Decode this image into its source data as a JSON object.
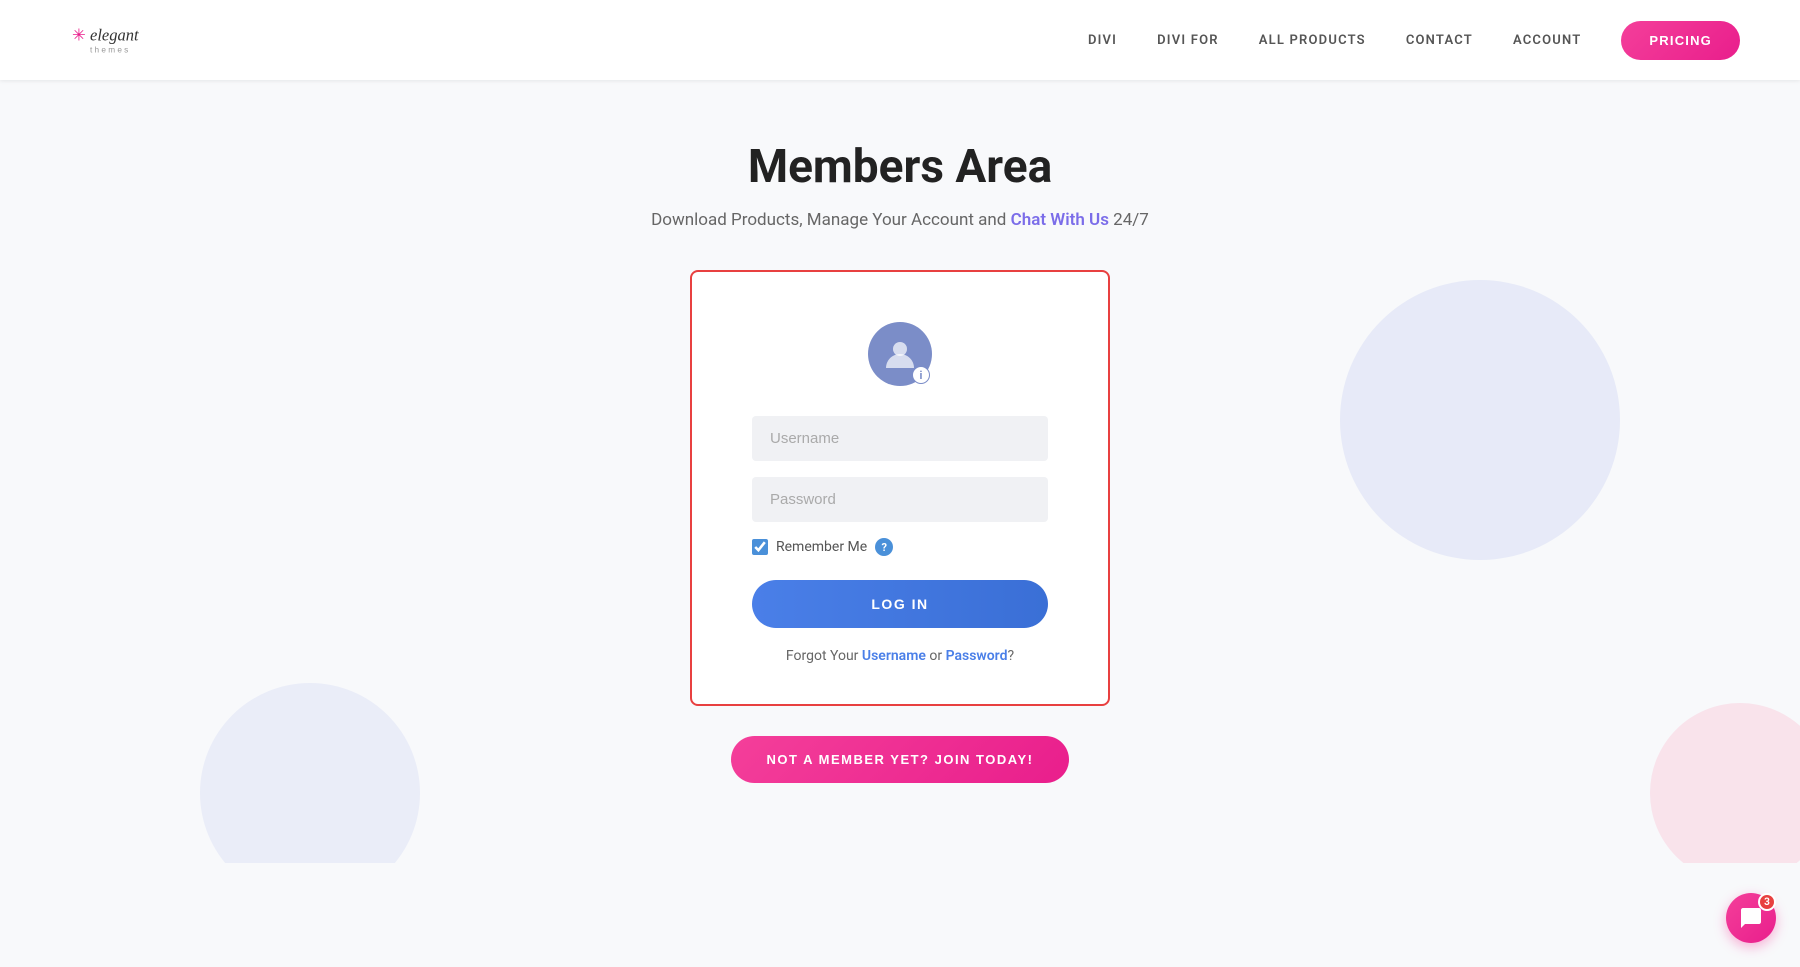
{
  "header": {
    "logo_alt": "Elegant Themes",
    "nav": {
      "items": [
        {
          "label": "DIVI",
          "id": "divi"
        },
        {
          "label": "DIVI FOR",
          "id": "divi-for"
        },
        {
          "label": "ALL PRODUCTS",
          "id": "all-products"
        },
        {
          "label": "CONTACT",
          "id": "contact"
        },
        {
          "label": "ACCOUNT",
          "id": "account"
        }
      ],
      "pricing_label": "PRICING"
    }
  },
  "hero": {
    "title": "Members Area",
    "subtitle_pre": "Download Products, Manage Your Account and ",
    "subtitle_link": "Chat With Us",
    "subtitle_post": " 24/7"
  },
  "login_form": {
    "username_placeholder": "Username",
    "password_placeholder": "Password",
    "remember_label": "Remember Me",
    "login_button": "LOG IN",
    "forgot_pre": "Forgot Your ",
    "forgot_username": "Username",
    "forgot_or": " or ",
    "forgot_password": "Password",
    "forgot_post": "?"
  },
  "join_button": "NOT A MEMBER YET? JOIN TODAY!",
  "chat_widget": {
    "badge": "3"
  }
}
